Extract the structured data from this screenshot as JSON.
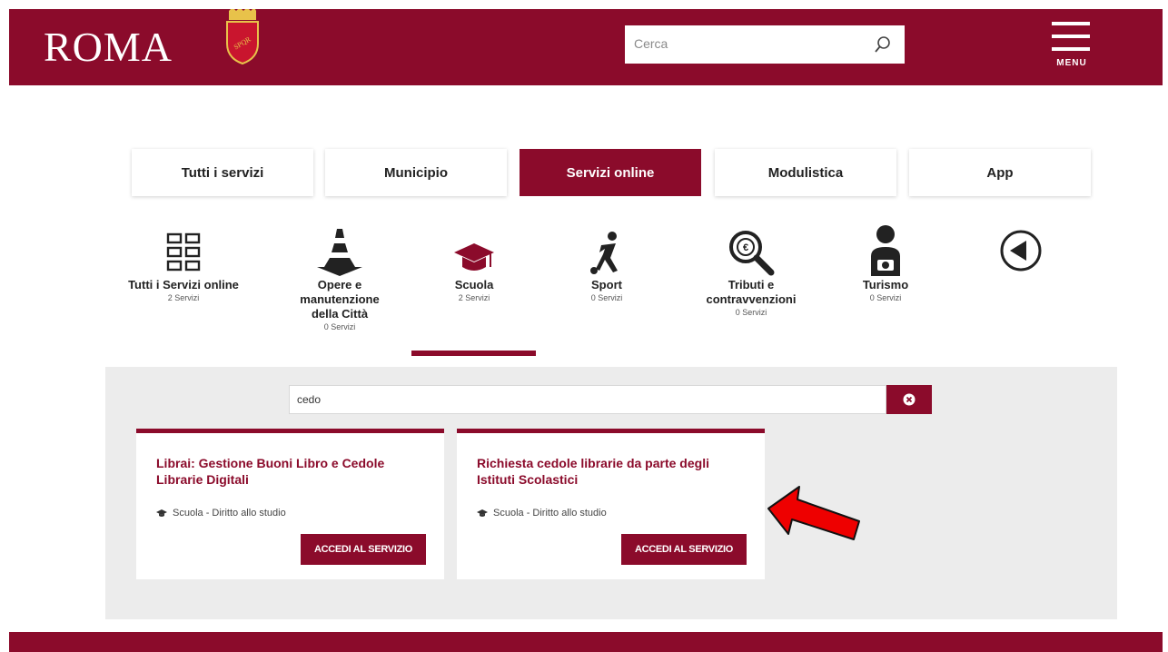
{
  "header": {
    "logo": "ROMA",
    "search_placeholder": "Cerca",
    "menu_label": "MENU"
  },
  "tabs": [
    {
      "label": "Tutti i servizi"
    },
    {
      "label": "Municipio"
    },
    {
      "label": "Servizi online",
      "active": true
    },
    {
      "label": "Modulistica"
    },
    {
      "label": "App"
    }
  ],
  "categories": [
    {
      "label": "Tutti i Servizi online",
      "count": "2 Servizi",
      "icon": "grid-icon"
    },
    {
      "label": "Opere e manutenzione della Città",
      "count": "0 Servizi",
      "icon": "traffic-cone-icon"
    },
    {
      "label": "Scuola",
      "count": "2 Servizi",
      "icon": "graduation-cap-icon",
      "selected": true
    },
    {
      "label": "Sport",
      "count": "0 Servizi",
      "icon": "runner-icon"
    },
    {
      "label": "Tributi e contravvenzioni",
      "count": "0 Servizi",
      "icon": "magnifier-coin-icon"
    },
    {
      "label": "Turismo",
      "count": "0 Servizi",
      "icon": "tourist-camera-icon"
    }
  ],
  "filter": {
    "value": "cedo"
  },
  "results": [
    {
      "title": "Librai: Gestione Buoni Libro e Cedole Librarie Digitali",
      "meta": "Scuola - Diritto allo studio",
      "button": "ACCEDI AL SERVIZIO"
    },
    {
      "title": "Richiesta cedole librarie da parte degli Istituti Scolastici",
      "meta": "Scuola - Diritto allo studio",
      "button": "ACCEDI AL SERVIZIO"
    }
  ],
  "colors": {
    "brand": "#8b0b2b",
    "panel": "#ececec",
    "annotation_arrow": "#ff0000"
  }
}
